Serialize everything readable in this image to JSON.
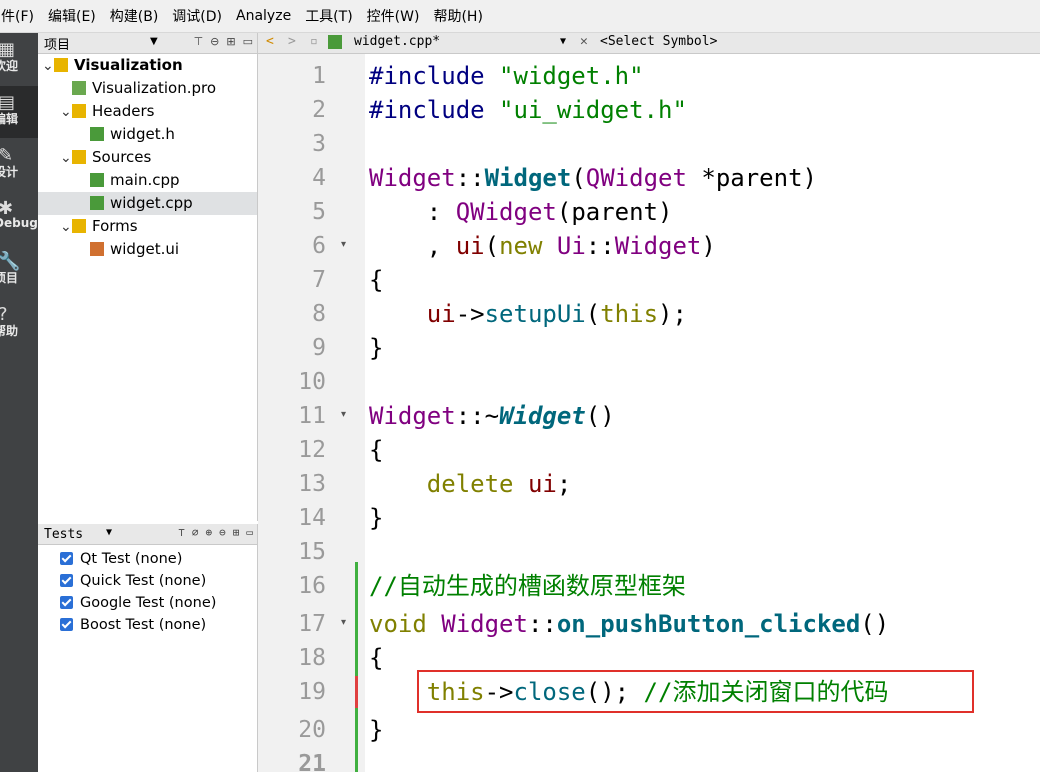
{
  "menu": [
    "件(F)",
    "编辑(E)",
    "构建(B)",
    "调试(D)",
    "Analyze",
    "工具(T)",
    "控件(W)",
    "帮助(H)"
  ],
  "modes": [
    {
      "label": "欢迎",
      "icon": "grid-icon"
    },
    {
      "label": "编辑",
      "icon": "edit-icon",
      "active": true
    },
    {
      "label": "设计",
      "icon": "pencil-icon"
    },
    {
      "label": "Debug",
      "icon": "bug-icon"
    },
    {
      "label": "项目",
      "icon": "wrench-icon"
    },
    {
      "label": "帮助",
      "icon": "help-icon"
    }
  ],
  "project": {
    "title": "项目",
    "tree": [
      {
        "label": "Visualization",
        "level": 0,
        "bold": true,
        "icon": "project-icon",
        "arrow": "expanded"
      },
      {
        "label": "Visualization.pro",
        "level": 1,
        "icon": "pro-file-icon"
      },
      {
        "label": "Headers",
        "level": 1,
        "icon": "folder-h-icon",
        "arrow": "expanded"
      },
      {
        "label": "widget.h",
        "level": 2,
        "icon": "header-file-icon"
      },
      {
        "label": "Sources",
        "level": 1,
        "icon": "folder-cpp-icon",
        "arrow": "expanded"
      },
      {
        "label": "main.cpp",
        "level": 2,
        "icon": "cpp-file-icon"
      },
      {
        "label": "widget.cpp",
        "level": 2,
        "icon": "cpp-file-icon",
        "selected": true
      },
      {
        "label": "Forms",
        "level": 1,
        "icon": "folder-ui-icon",
        "arrow": "expanded"
      },
      {
        "label": "widget.ui",
        "level": 2,
        "icon": "ui-file-icon"
      }
    ]
  },
  "tests": {
    "title": "Tests",
    "items": [
      "Qt Test (none)",
      "Quick Test (none)",
      "Google Test (none)",
      "Boost Test (none)"
    ]
  },
  "editor": {
    "file_tab": "widget.cpp*",
    "symbol": "<Select Symbol>",
    "line_numbers": [
      "1",
      "2",
      "3",
      "4",
      "5",
      "6",
      "7",
      "8",
      "9",
      "10",
      "11",
      "12",
      "13",
      "14",
      "15",
      "16",
      "17",
      "18",
      "19",
      "20",
      "21"
    ],
    "fold_lines": [
      6,
      11,
      17
    ]
  },
  "colors": {
    "highlight_box": "#e0302a",
    "modebar": "#404244",
    "change_marker": "#40b040"
  }
}
